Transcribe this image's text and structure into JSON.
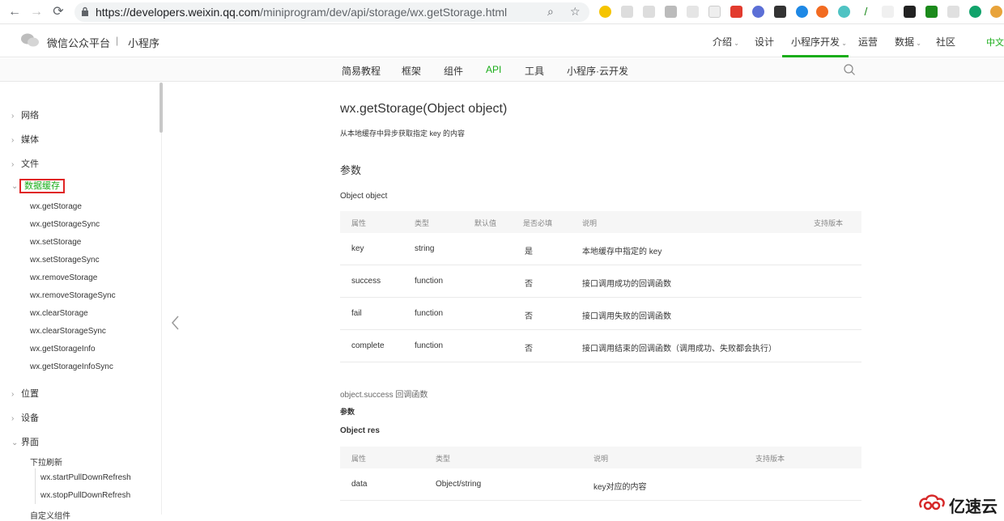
{
  "browser": {
    "url_host": "https://developers.weixin.qq.com",
    "url_path": "/miniprogram/dev/api/storage/wx.getStorage.html"
  },
  "header": {
    "brand": "微信公众平台",
    "separator": "|",
    "brand_sub": "小程序",
    "nav": [
      "介绍",
      "设计",
      "小程序开发",
      "运营",
      "数据",
      "社区"
    ],
    "lang": "中文"
  },
  "subnav": [
    "简易教程",
    "框架",
    "组件",
    "API",
    "工具",
    "小程序·云开发"
  ],
  "sidebar": {
    "categories": [
      "网络",
      "媒体",
      "文件",
      "数据缓存",
      "位置",
      "设备",
      "界面"
    ],
    "storage_items": [
      "wx.getStorage",
      "wx.getStorageSync",
      "wx.setStorage",
      "wx.setStorageSync",
      "wx.removeStorage",
      "wx.removeStorageSync",
      "wx.clearStorage",
      "wx.clearStorageSync",
      "wx.getStorageInfo",
      "wx.getStorageInfoSync"
    ],
    "ui_group": "下拉刷新",
    "ui_items": [
      "wx.startPullDownRefresh",
      "wx.stopPullDownRefresh"
    ],
    "ui_next": "自定义组件"
  },
  "content": {
    "title": "wx.getStorage(Object object)",
    "desc": "从本地缓存中异步获取指定 key 的内容",
    "params_heading": "参数",
    "object_label": "Object object",
    "table1": {
      "headers": [
        "属性",
        "类型",
        "默认值",
        "是否必填",
        "说明",
        "支持版本"
      ],
      "rows": [
        [
          "key",
          "string",
          "",
          "是",
          "本地缓存中指定的 key"
        ],
        [
          "success",
          "function",
          "",
          "否",
          "接口调用成功的回调函数"
        ],
        [
          "fail",
          "function",
          "",
          "否",
          "接口调用失败的回调函数"
        ],
        [
          "complete",
          "function",
          "",
          "否",
          "接口调用结束的回调函数（调用成功、失败都会执行）"
        ]
      ]
    },
    "success_note": "object.success 回调函数",
    "success_params": "参数",
    "res_label": "Object res",
    "table2": {
      "headers": [
        "属性",
        "类型",
        "说明",
        "支持版本"
      ],
      "rows": [
        [
          "data",
          "Object/string",
          "key对应的内容"
        ]
      ]
    }
  },
  "watermark": "亿速云",
  "colors": {
    "accent": "#1aad19",
    "highlight_box": "#e02424"
  }
}
